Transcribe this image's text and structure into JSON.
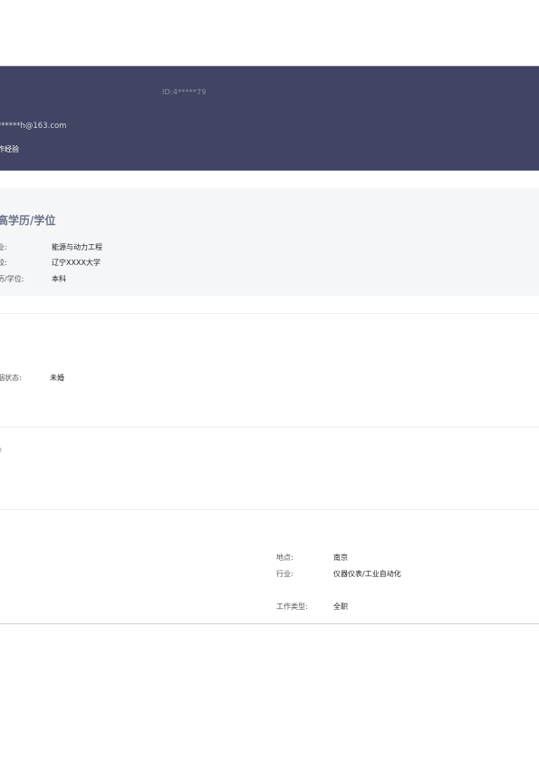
{
  "header": {
    "id_text": "ID:4*****79",
    "email": "******h@163.com",
    "experience": "作经验"
  },
  "education": {
    "title": "高学历/学位",
    "rows": [
      {
        "label": "业:",
        "value": "能源与动力工程"
      },
      {
        "label": "校:",
        "value": "辽宁XXXX大学"
      },
      {
        "label": "历/学位:",
        "value": "本科"
      }
    ]
  },
  "marital": {
    "label": "姻状态:",
    "value": "未婚"
  },
  "section3": {
    "chevron": "〉"
  },
  "intention": {
    "rows": [
      {
        "label": "地点:",
        "value": "南京"
      },
      {
        "label": "行业:",
        "value": "仪器仪表/工业自动化"
      },
      {
        "label": "工作类型:",
        "value": "全职"
      }
    ]
  }
}
